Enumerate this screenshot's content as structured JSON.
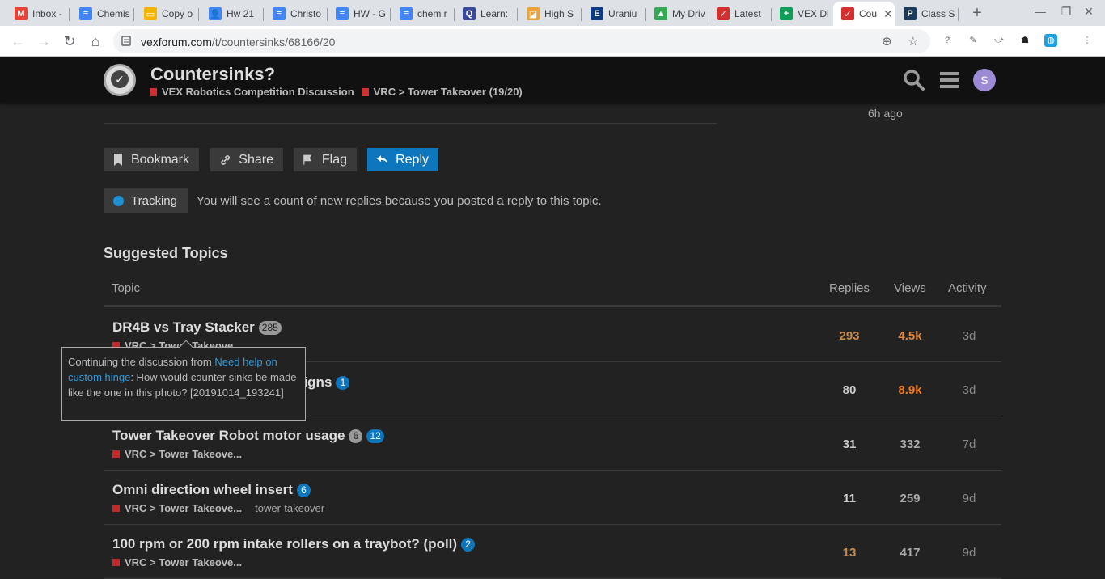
{
  "browser": {
    "tabs": [
      {
        "label": "Inbox -",
        "icon": "gmail-icon",
        "color": "#ea4335",
        "glyph": "M"
      },
      {
        "label": "Chemis",
        "icon": "docs-icon",
        "color": "#4285f4",
        "glyph": "≡"
      },
      {
        "label": "Copy o",
        "icon": "slides-icon",
        "color": "#f4b400",
        "glyph": "▭"
      },
      {
        "label": "Hw 21",
        "icon": "classroom-icon",
        "color": "#4285f4",
        "glyph": "👤"
      },
      {
        "label": "Christo",
        "icon": "docs-icon",
        "color": "#4285f4",
        "glyph": "≡"
      },
      {
        "label": "HW - G",
        "icon": "docs-icon",
        "color": "#4285f4",
        "glyph": "≡"
      },
      {
        "label": "chem r",
        "icon": "docs-icon",
        "color": "#4285f4",
        "glyph": "≡"
      },
      {
        "label": "Learn:",
        "icon": "quizlet-icon",
        "color": "#3a4a9a",
        "glyph": "Q"
      },
      {
        "label": "High S",
        "icon": "bookmark-icon",
        "color": "#e8a33d",
        "glyph": "◪"
      },
      {
        "label": "Uraniu",
        "icon": "encyclopedia-icon",
        "color": "#0d3b82",
        "glyph": "E"
      },
      {
        "label": "My Driv",
        "icon": "drive-icon",
        "color": "#34a853",
        "glyph": "▲"
      },
      {
        "label": "Latest",
        "icon": "vex-icon",
        "color": "#d32f2f",
        "glyph": "✓"
      },
      {
        "label": "VEX Di",
        "icon": "sheets-icon",
        "color": "#0f9d58",
        "glyph": "+"
      },
      {
        "label": "Cou",
        "icon": "vex-icon",
        "color": "#d32f2f",
        "glyph": "✓"
      },
      {
        "label": "Class S",
        "icon": "powerschool-icon",
        "color": "#1b3a5c",
        "glyph": "P"
      }
    ],
    "url_host": "vexforum.com",
    "url_path": "/t/countersinks/68166/20"
  },
  "header": {
    "title": "Countersinks?",
    "category1": "VEX Robotics Competition Discussion",
    "category2": "VRC > Tower Takeover (19/20)",
    "avatar_letter": "S"
  },
  "post": {
    "time_ago": "6h ago"
  },
  "actions": {
    "bookmark": "Bookmark",
    "share": "Share",
    "flag": "Flag",
    "reply": "Reply"
  },
  "tracking": {
    "label": "Tracking",
    "text": "You will see a count of new replies because you posted a reply to this topic."
  },
  "suggested": {
    "heading": "Suggested Topics",
    "col_topic": "Topic",
    "col_replies": "Replies",
    "col_views": "Views",
    "col_activity": "Activity",
    "rows": [
      {
        "title": "DR4B vs Tray Stacker",
        "grey_badge": "285",
        "blue_badge": "",
        "category": "VRC > Tower Takeove...",
        "tag": "",
        "replies": "293",
        "views": "4.5k",
        "activity": "3d"
      },
      {
        "title": "signs",
        "grey_badge": "",
        "blue_badge": "1",
        "category": "",
        "tag": "",
        "replies": "80",
        "views": "8.9k",
        "activity": "3d"
      },
      {
        "title": "Tower Takeover Robot motor usage",
        "grey_badge": "6",
        "blue_badge": "12",
        "category": "VRC > Tower Takeove...",
        "tag": "",
        "replies": "31",
        "views": "332",
        "activity": "7d"
      },
      {
        "title": "Omni direction wheel insert",
        "grey_badge": "",
        "blue_badge": "6",
        "category": "VRC > Tower Takeove...",
        "tag": "tower-takeover",
        "replies": "11",
        "views": "259",
        "activity": "9d"
      },
      {
        "title": "100 rpm or 200 rpm intake rollers on a traybot? (poll)",
        "grey_badge": "",
        "blue_badge": "2",
        "category": "VRC > Tower Takeove...",
        "tag": "",
        "replies": "13",
        "views": "417",
        "activity": "9d"
      }
    ]
  },
  "tooltip": {
    "prefix": "Continuing the discussion from ",
    "link": "Need help on custom hinge",
    "body": ": How would counter sinks be made like the one in this photo? [20191014_193241]"
  },
  "colors": {
    "hot_replies": "#c98a4b",
    "hot_views_1": "#e0873f",
    "hot_views_2": "#f07c1e",
    "normal": "#aaa",
    "accent": "#0e76bd"
  }
}
